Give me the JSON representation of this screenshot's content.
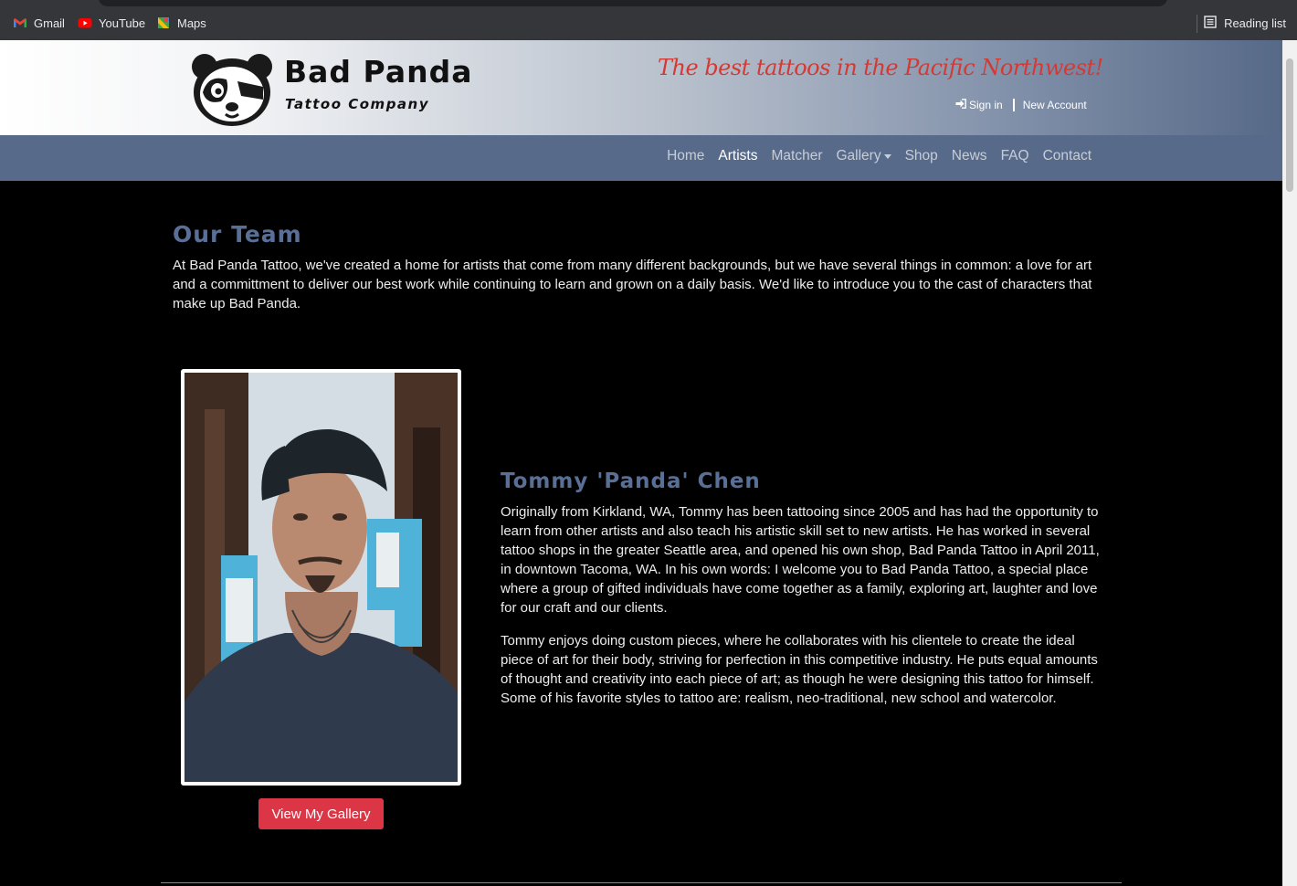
{
  "browser": {
    "bookmarks": [
      {
        "label": "Gmail",
        "icon": "gmail-icon"
      },
      {
        "label": "YouTube",
        "icon": "youtube-icon"
      },
      {
        "label": "Maps",
        "icon": "maps-icon"
      }
    ],
    "reading_list": "Reading list"
  },
  "header": {
    "brand_name": "Bad Panda",
    "brand_sub": "Tattoo Company",
    "tagline": "The best tattoos in the Pacific Northwest!",
    "sign_in": "Sign in",
    "new_account": "New Account"
  },
  "nav": {
    "items": [
      {
        "label": "Home"
      },
      {
        "label": "Artists",
        "active": true
      },
      {
        "label": "Matcher"
      },
      {
        "label": "Gallery",
        "dropdown": true
      },
      {
        "label": "Shop"
      },
      {
        "label": "News"
      },
      {
        "label": "FAQ"
      },
      {
        "label": "Contact"
      }
    ]
  },
  "team": {
    "title": "Our Team",
    "intro": "At Bad Panda Tattoo, we've created a home for artists that come from many different backgrounds, but we have several things in common: a love for art and a committment to deliver our best work while continuing to learn and grown on a daily basis. We'd like to introduce you to the cast of characters that make up Bad Panda."
  },
  "artist": {
    "name": "Tommy 'Panda' Chen",
    "gallery_button": "View My Gallery",
    "bio_p1": "Originally from Kirkland, WA, Tommy has been tattooing since 2005 and has had the opportunity to learn from other artists and also teach his artistic skill set to new artists. He has worked in several tattoo shops in the greater Seattle area, and opened his own shop, Bad Panda Tattoo in April 2011, in downtown Tacoma, WA. In his own words: I welcome you to Bad Panda Tattoo, a special place where a group of gifted individuals have come together as a family, exploring art, laughter and love for our craft and our clients.",
    "bio_p2": "Tommy enjoys doing custom pieces, where he collaborates with his clientele to create the ideal piece of art for their body, striving for perfection in this competitive industry. He puts equal amounts of thought and creativity into each piece of art; as though he were designing this tattoo for himself. Some of his favorite styles to tattoo are: realism, neo-traditional, new school and watercolor."
  },
  "colors": {
    "accent_heading": "#5a6f95",
    "navbar": "#586a89",
    "tagline": "#d33a33",
    "button": "#dc3545"
  }
}
